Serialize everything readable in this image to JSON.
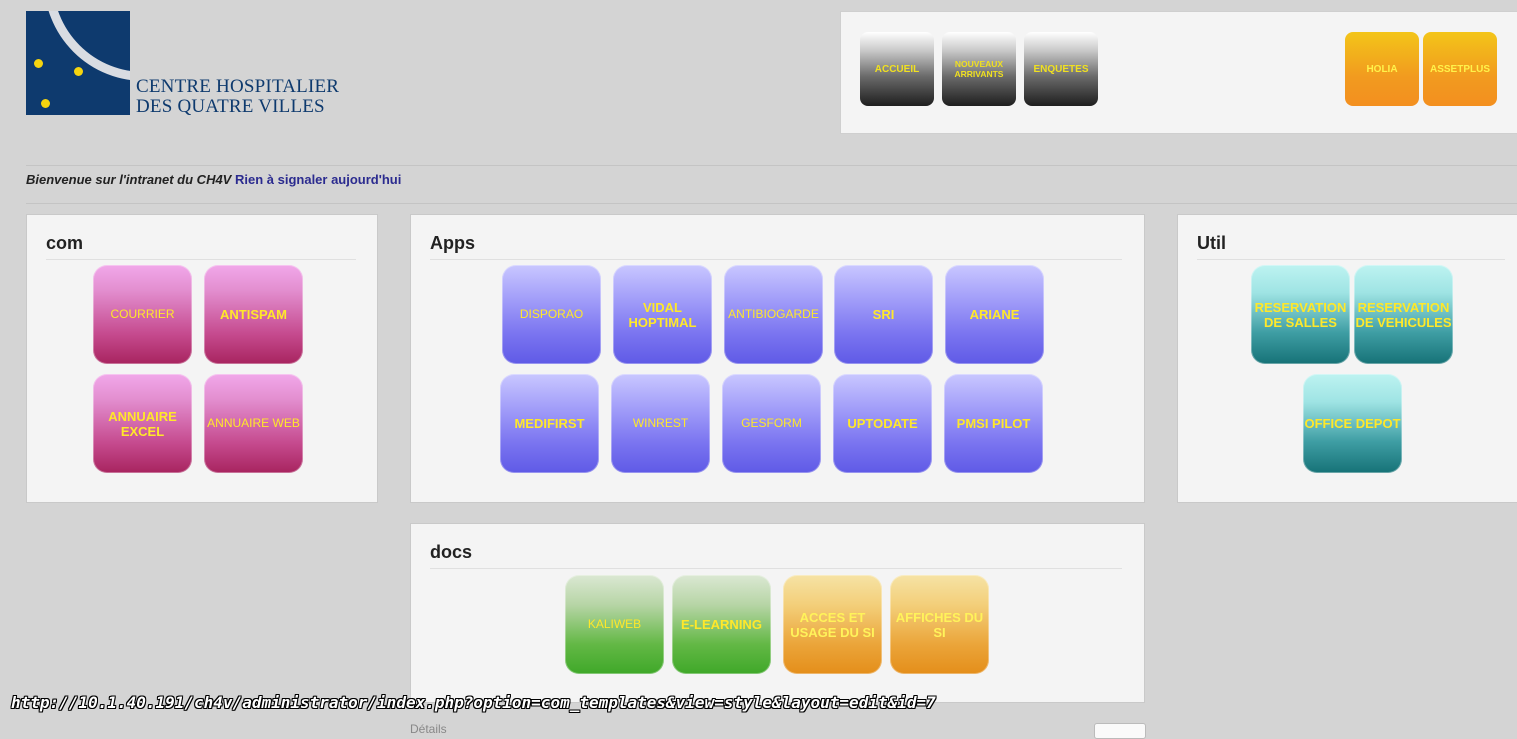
{
  "logo": {
    "line1": "CENTRE HOSPITALIER",
    "line2": "DES QUATRE VILLES",
    "colors": {
      "navy": "#0e3a6e",
      "dot": "#f5d40f"
    }
  },
  "nav": {
    "accueil": "ACCUEIL",
    "nouveaux_arrivants": "NOUVEAUX ARRIVANTS",
    "enquetes": "ENQUETES",
    "holia": "HOLIA",
    "assetplus": "ASSETPLUS"
  },
  "welcome": {
    "text": "Bienvenue sur l'intranet du CH4V",
    "status": "Rien à signaler aujourd'hui"
  },
  "com": {
    "title": "com",
    "tiles": [
      "COURRIER",
      "ANTISPAM",
      "ANNUAIRE EXCEL",
      "ANNUAIRE WEB"
    ]
  },
  "apps": {
    "title": "Apps",
    "tiles": [
      "DISPORAO",
      "VIDAL HOPTIMAL",
      "ANTIBIOGARDE",
      "SRI",
      "ARIANE",
      "MEDIFIRST",
      "WINREST",
      "GESFORM",
      "UPTODATE",
      "PMSI PILOT"
    ]
  },
  "util": {
    "title": "Util",
    "tiles": [
      "RESERVATION DE SALLES",
      "RESERVATION DE VEHICULES",
      "OFFICE DEPOT"
    ]
  },
  "docs": {
    "title": "docs",
    "tiles": [
      "KALIWEB",
      "E-LEARNING",
      "ACCES ET USAGE DU SI",
      "AFFICHES DU SI"
    ]
  },
  "status_bar": {
    "url": "http://10.1.40.191/ch4v/administrator/index.php?option=com_templates&view=style&layout=edit&id=7"
  },
  "footer": {
    "partial": "Détails"
  }
}
